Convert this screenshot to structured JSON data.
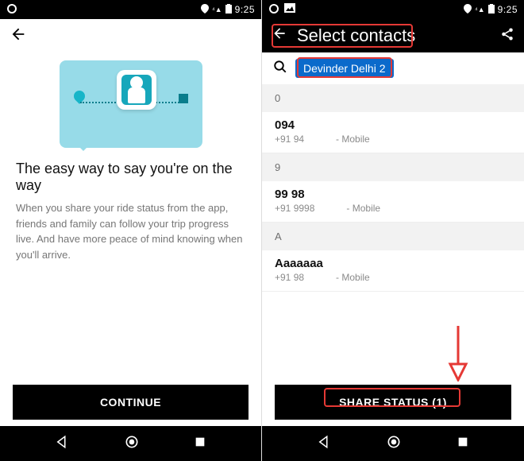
{
  "status_bar": {
    "time": "9:25",
    "icons_left": [
      "uber-app-icon",
      "gallery-icon"
    ],
    "icons_right": [
      "location-icon",
      "signal-icon",
      "battery-icon"
    ]
  },
  "left": {
    "title": "The easy way to say you're on the way",
    "body": "When you share your ride status from the app, friends and family can follow your trip progress live. And have more peace of mind knowing when you'll arrive.",
    "continue_label": "CONTINUE"
  },
  "right": {
    "header_title": "Select contacts",
    "chip_text": "Devinder Delhi 2",
    "sections": [
      {
        "letter": "0",
        "rows": [
          {
            "name": "094",
            "sub_number": "+91 94",
            "sub_type": "- Mobile"
          }
        ]
      },
      {
        "letter": "9",
        "rows": [
          {
            "name": "99 98",
            "sub_number": "+91 9998",
            "sub_type": "- Mobile"
          }
        ]
      },
      {
        "letter": "A",
        "rows": [
          {
            "name": "Aaaaaaa",
            "sub_number": "+91 98",
            "sub_type": "- Mobile"
          }
        ]
      }
    ],
    "share_label": "SHARE STATUS (1)"
  }
}
